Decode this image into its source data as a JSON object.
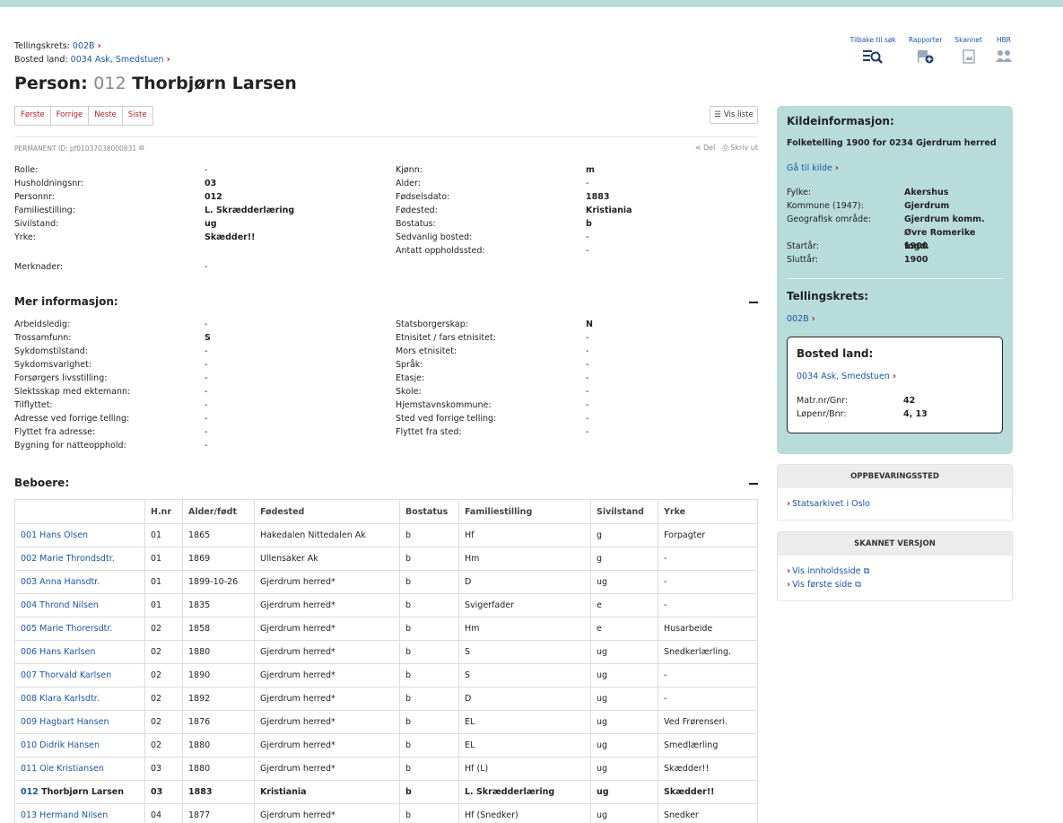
{
  "breadcrumb": {
    "tellingskrets_label": "Tellingskrets:",
    "tellingskrets_value": "002B",
    "bosted_label": "Bosted land:",
    "bosted_value": "0034 Ask, Smedstuen"
  },
  "tools": [
    {
      "label": "Tilbake til søk",
      "icon": "search-list-icon"
    },
    {
      "label": "Rapporter",
      "icon": "flag-plus-icon"
    },
    {
      "label": "Skannet",
      "icon": "image-icon"
    },
    {
      "label": "HBR",
      "icon": "group-icon"
    }
  ],
  "title": {
    "prefix": "Person:",
    "number": "012",
    "name": "Thorbjørn Larsen"
  },
  "pager": {
    "first": "Første",
    "prev": "Forrige",
    "next": "Neste",
    "last": "Siste"
  },
  "vis_liste": "Vis liste",
  "permanent_id": "PERMANENT ID: pf01037038000831",
  "share": {
    "del": "Del",
    "print": "Skriv ut"
  },
  "person": {
    "left": [
      {
        "k": "Rolle:",
        "v": "-"
      },
      {
        "k": "Husholdningsnr:",
        "v": "03"
      },
      {
        "k": "Personnr:",
        "v": "012"
      },
      {
        "k": "Familiestilling:",
        "v": "L. Skrædderlæring"
      },
      {
        "k": "Sivilstand:",
        "v": "ug"
      },
      {
        "k": "Yrke:",
        "v": "Skædder!!"
      }
    ],
    "right": [
      {
        "k": "Kjønn:",
        "v": "m"
      },
      {
        "k": "Alder:",
        "v": "-"
      },
      {
        "k": "Fødselsdato:",
        "v": "1883"
      },
      {
        "k": "Fødested:",
        "v": "Kristiania"
      },
      {
        "k": "Bostatus:",
        "v": "b"
      },
      {
        "k": "Sedvanlig bosted:",
        "v": "-"
      },
      {
        "k": "Antatt oppholdssted:",
        "v": "-"
      }
    ],
    "merknader_k": "Merknader:",
    "merknader_v": "-"
  },
  "mer": {
    "title": "Mer informasjon:",
    "left": [
      {
        "k": "Arbeidsledig:",
        "v": "-"
      },
      {
        "k": "Trossamfunn:",
        "v": "S"
      },
      {
        "k": "Sykdomstilstand:",
        "v": "-"
      },
      {
        "k": "Sykdomsvarighet:",
        "v": "-"
      },
      {
        "k": "Forsørgers livsstilling:",
        "v": "-"
      },
      {
        "k": "Slektsskap med ektemann:",
        "v": "-"
      },
      {
        "k": "Tilflyttet:",
        "v": "-"
      },
      {
        "k": "Adresse ved forrige telling:",
        "v": "-"
      },
      {
        "k": "Flyttet fra adresse:",
        "v": "-"
      },
      {
        "k": "Bygning for natteopphold:",
        "v": "-"
      }
    ],
    "right": [
      {
        "k": "Statsborgerskap:",
        "v": "N"
      },
      {
        "k": "Etnisitet / fars etnisitet:",
        "v": "-"
      },
      {
        "k": "Mors etnisitet:",
        "v": "-"
      },
      {
        "k": "Språk:",
        "v": "-"
      },
      {
        "k": "Etasje:",
        "v": "-"
      },
      {
        "k": "Skole:",
        "v": "-"
      },
      {
        "k": "Hjemstavnskommune:",
        "v": "-"
      },
      {
        "k": "Sted ved forrige telling:",
        "v": "-"
      },
      {
        "k": "Flyttet fra sted:",
        "v": "-"
      }
    ]
  },
  "beboere": {
    "title": "Beboere:",
    "columns": [
      "",
      "H.nr",
      "Alder/født",
      "Fødested",
      "Bostatus",
      "Familiestilling",
      "Sivilstand",
      "Yrke"
    ],
    "rows": [
      {
        "nr": "001",
        "name": "Hans Olsen",
        "hnr": "01",
        "born": "1865",
        "place": "Hakedalen Nittedalen Ak",
        "status": "b",
        "fam": "Hf",
        "civ": "g",
        "job": "Forpagter"
      },
      {
        "nr": "002",
        "name": "Marie Throndsdtr.",
        "hnr": "01",
        "born": "1869",
        "place": "Ullensaker Ak",
        "status": "b",
        "fam": "Hm",
        "civ": "g",
        "job": "-"
      },
      {
        "nr": "003",
        "name": "Anna Hansdtr.",
        "hnr": "01",
        "born": "1899-10-26",
        "place": "Gjerdrum herred*",
        "status": "b",
        "fam": "D",
        "civ": "ug",
        "job": "-"
      },
      {
        "nr": "004",
        "name": "Thrond Nilsen",
        "hnr": "01",
        "born": "1835",
        "place": "Gjerdrum herred*",
        "status": "b",
        "fam": "Svigerfader",
        "civ": "e",
        "job": "-"
      },
      {
        "nr": "005",
        "name": "Marie Thorersdtr.",
        "hnr": "02",
        "born": "1858",
        "place": "Gjerdrum herred*",
        "status": "b",
        "fam": "Hm",
        "civ": "e",
        "job": "Husarbeide"
      },
      {
        "nr": "006",
        "name": "Hans Karlsen",
        "hnr": "02",
        "born": "1880",
        "place": "Gjerdrum herred*",
        "status": "b",
        "fam": "S",
        "civ": "ug",
        "job": "Snedkerlærling."
      },
      {
        "nr": "007",
        "name": "Thorvald Karlsen",
        "hnr": "02",
        "born": "1890",
        "place": "Gjerdrum herred*",
        "status": "b",
        "fam": "S",
        "civ": "ug",
        "job": "-"
      },
      {
        "nr": "008",
        "name": "Klara Karlsdtr.",
        "hnr": "02",
        "born": "1892",
        "place": "Gjerdrum herred*",
        "status": "b",
        "fam": "D",
        "civ": "ug",
        "job": "-"
      },
      {
        "nr": "009",
        "name": "Hagbart Hansen",
        "hnr": "02",
        "born": "1876",
        "place": "Gjerdrum herred*",
        "status": "b",
        "fam": "EL",
        "civ": "ug",
        "job": "Ved Frørenseri."
      },
      {
        "nr": "010",
        "name": "Didrik Hansen",
        "hnr": "02",
        "born": "1880",
        "place": "Gjerdrum herred*",
        "status": "b",
        "fam": "EL",
        "civ": "ug",
        "job": "Smedlærling"
      },
      {
        "nr": "011",
        "name": "Ole Kristiansen",
        "hnr": "03",
        "born": "1880",
        "place": "Gjerdrum herred*",
        "status": "b",
        "fam": "Hf (L)",
        "civ": "ug",
        "job": "Skædder!!"
      },
      {
        "nr": "012",
        "name": "Thorbjørn Larsen",
        "hnr": "03",
        "born": "1883",
        "place": "Kristiania",
        "status": "b",
        "fam": "L. Skrædderlæring",
        "civ": "ug",
        "job": "Skædder!!",
        "current": true
      },
      {
        "nr": "013",
        "name": "Hermand Nilsen",
        "hnr": "04",
        "born": "1877",
        "place": "Gjerdrum herred*",
        "status": "b",
        "fam": "Hf (Snedker)",
        "civ": "ug",
        "job": "Snedker"
      }
    ]
  },
  "kilde": {
    "title": "Kildeinformasjon:",
    "source": "Folketelling 1900 for 0234 Gjerdrum herred",
    "goto": "Gå til kilde",
    "fields": [
      {
        "k": "Fylke:",
        "v": "Akershus"
      },
      {
        "k": "Kommune (1947):",
        "v": "Gjerdrum"
      },
      {
        "k": "Geografisk område:",
        "v": "Gjerdrum komm."
      },
      {
        "k": "",
        "v": "Øvre Romerike fogd."
      },
      {
        "k": "Startår:",
        "v": "1900"
      },
      {
        "k": "Sluttår:",
        "v": "1900"
      }
    ],
    "tellingskrets_title": "Tellingskrets:",
    "tellingskrets_link": "002B",
    "bosted_title": "Bosted land:",
    "bosted_link": "0034 Ask, Smedstuen",
    "bosted_fields": [
      {
        "k": "Matr.nr/Gnr:",
        "v": "42"
      },
      {
        "k": "Løpenr/Bnr:",
        "v": "4, 13"
      }
    ]
  },
  "oppbevaring": {
    "title": "OPPBEVARINGSSTED",
    "link": "Statsarkivet i Oslo"
  },
  "skannet": {
    "title": "SKANNET VERSJON",
    "link1": "Vis innholdsside",
    "link2": "Vis første side"
  }
}
